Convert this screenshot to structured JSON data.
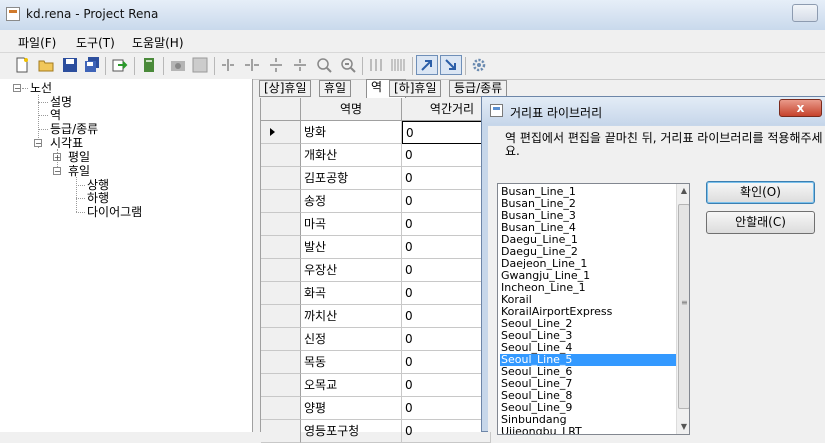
{
  "window": {
    "title": "kd.rena - Project Rena"
  },
  "menu": [
    "파일(F)",
    "도구(T)",
    "도움말(H)"
  ],
  "toolbar": {
    "icons": [
      "new-file-icon",
      "open-folder-icon",
      "save-icon",
      "save-all-icon",
      "export-icon",
      "book-icon",
      "camera-icon",
      "grid-icon",
      "split-h-icon",
      "join-h-icon",
      "split-v-icon",
      "join-v-icon",
      "zoom-in-icon",
      "zoom-out-icon",
      "bars-icon",
      "bars-wide-icon",
      "arrow-up-right-icon",
      "arrow-down-right-icon",
      "settings-gear-icon"
    ]
  },
  "tree": {
    "root": "노선",
    "children": [
      "설명",
      "역",
      "등급/종류",
      "시각표"
    ],
    "timetable_children": [
      "평일",
      "휴일"
    ],
    "holiday_children": [
      "상행",
      "하행",
      "다이어그램"
    ]
  },
  "tabs": [
    "[상]휴일",
    "휴일",
    "역",
    "[하]휴일",
    "등급/종류"
  ],
  "grid": {
    "columns": [
      "역명",
      "역간거리"
    ],
    "rows": [
      [
        "방화",
        "0"
      ],
      [
        "개화산",
        "0"
      ],
      [
        "김포공항",
        "0"
      ],
      [
        "송정",
        "0"
      ],
      [
        "마곡",
        "0"
      ],
      [
        "발산",
        "0"
      ],
      [
        "우장산",
        "0"
      ],
      [
        "화곡",
        "0"
      ],
      [
        "까치산",
        "0"
      ],
      [
        "신정",
        "0"
      ],
      [
        "목동",
        "0"
      ],
      [
        "오목교",
        "0"
      ],
      [
        "양평",
        "0"
      ],
      [
        "영등포구청",
        "0"
      ]
    ]
  },
  "dialog": {
    "title": "거리표 라이브러리",
    "close": "x",
    "message": "역 편집에서 편집을 끝마친 뒤, 거리표 라이브러리를 적용해주세요.",
    "list": [
      "Busan_Line_1",
      "Busan_Line_2",
      "Busan_Line_3",
      "Busan_Line_4",
      "Daegu_Line_1",
      "Daegu_Line_2",
      "Daejeon_Line_1",
      "Gwangju_Line_1",
      "Incheon_Line_1",
      "Korail",
      "KorailAirportExpress",
      "Seoul_Line_2",
      "Seoul_Line_3",
      "Seoul_Line_4",
      "Seoul_Line_5",
      "Seoul_Line_6",
      "Seoul_Line_7",
      "Seoul_Line_8",
      "Seoul_Line_9",
      "Sinbundang",
      "Uijeongbu_LRT"
    ],
    "selected_item": "Seoul_Line_5",
    "ok": "확인(O)",
    "cancel": "안할래(C)"
  }
}
